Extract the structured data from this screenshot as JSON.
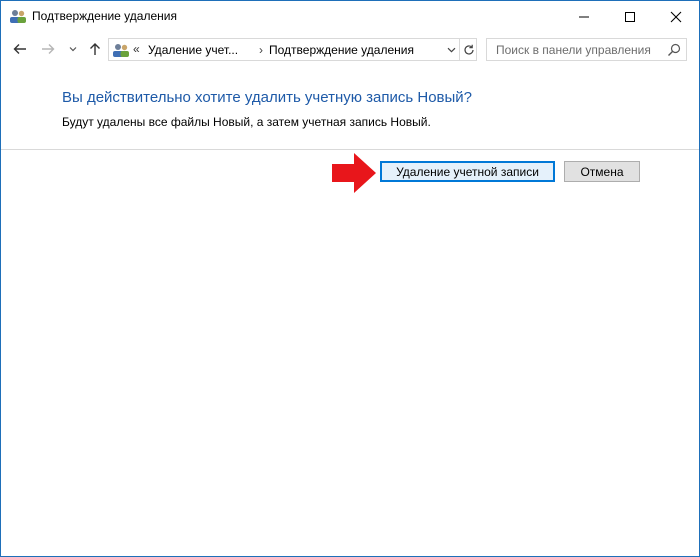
{
  "window": {
    "title": "Подтверждение удаления",
    "title_icon": "users-icon"
  },
  "address_bar": {
    "prefix": "«",
    "crumbs": [
      "Удаление учет...",
      "Подтверждение удаления"
    ],
    "separator": "›"
  },
  "search": {
    "placeholder": "Поиск в панели управления"
  },
  "content": {
    "heading": "Вы действительно хотите удалить учетную запись Новый?",
    "description": "Будут удалены все файлы Новый, а затем учетная запись Новый."
  },
  "buttons": {
    "delete_label": "Удаление учетной записи",
    "cancel_label": "Отмена"
  },
  "colors": {
    "heading": "#1e5aa8",
    "accent": "#0078d7",
    "arrow": "#e8161b"
  }
}
